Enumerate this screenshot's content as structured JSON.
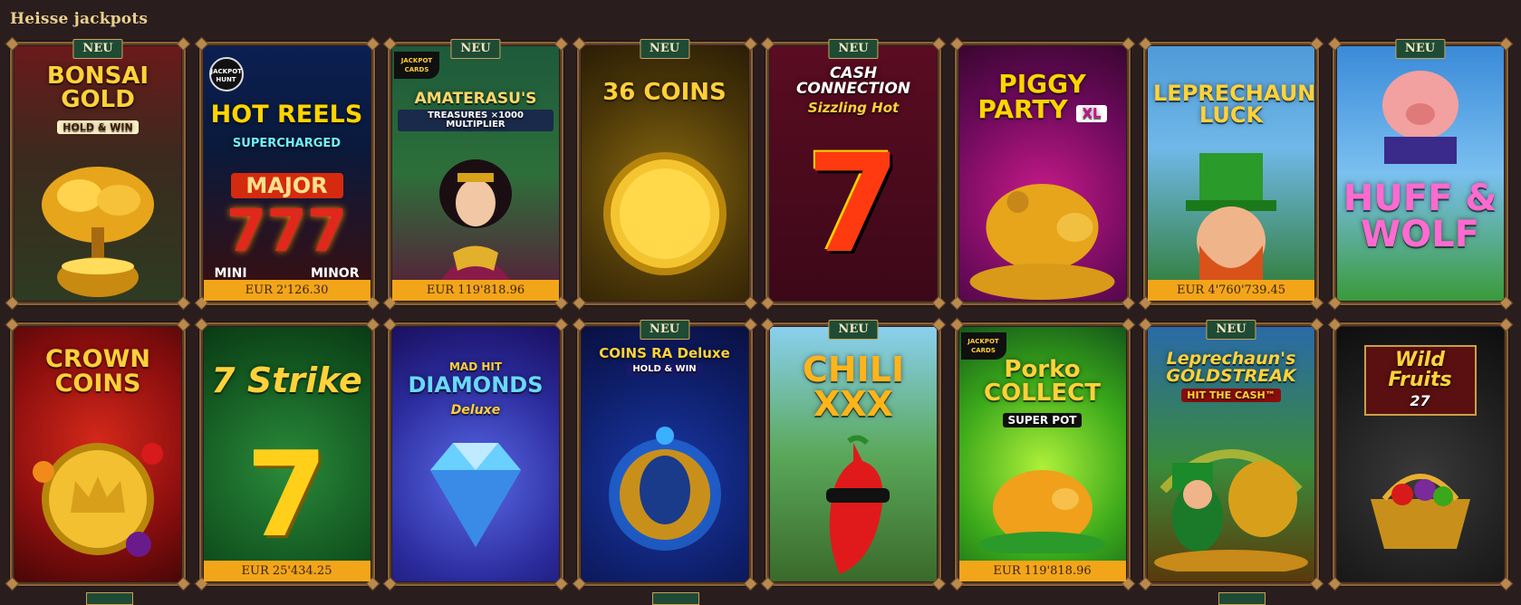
{
  "section": {
    "title": "Heisse jackpots"
  },
  "games": [
    {
      "name": "BONSAI GOLD",
      "sub": "HOLD & WIN",
      "badge": "NEU",
      "jackpot": ""
    },
    {
      "name": "HOT REELS",
      "sub": "SUPERCHARGED",
      "badge": "",
      "jackpot": "EUR 2'126.30",
      "extra": [
        "MAJOR",
        "MINI",
        "MINOR"
      ],
      "logo": "JACKPOT HUNT"
    },
    {
      "name": "AMATERASU'S",
      "sub": "TREASURES ×1000 MULTIPLIER",
      "badge": "NEU",
      "jackpot": "EUR 119'818.96",
      "logo": "JACKPOT CARDS"
    },
    {
      "name": "36 COINS",
      "sub": "",
      "badge": "NEU",
      "jackpot": ""
    },
    {
      "name": "CASH CONNECTION",
      "sub": "Sizzling Hot",
      "badge": "NEU",
      "jackpot": ""
    },
    {
      "name": "PIGGY PARTY",
      "sub": "XL",
      "badge": "",
      "jackpot": ""
    },
    {
      "name": "LEPRECHAUN'S LUCK",
      "sub": "",
      "badge": "",
      "jackpot": "EUR 4'760'739.45"
    },
    {
      "name": "HUFF & WOLF",
      "sub": "",
      "badge": "NEU",
      "jackpot": ""
    },
    {
      "name": "CROWN COINS",
      "sub": "",
      "badge": "",
      "jackpot": ""
    },
    {
      "name": "7 Strike",
      "sub": "",
      "badge": "",
      "jackpot": "EUR 25'434.25"
    },
    {
      "name": "DIAMONDS",
      "sub": "Deluxe",
      "badge": "",
      "jackpot": "",
      "logo": "MAD HIT"
    },
    {
      "name": "COINS RA Deluxe",
      "sub": "HOLD & WIN",
      "badge": "NEU",
      "jackpot": ""
    },
    {
      "name": "CHILI XXX",
      "sub": "",
      "badge": "NEU",
      "jackpot": ""
    },
    {
      "name": "Porko COLLECT",
      "sub": "SUPER POT",
      "badge": "",
      "jackpot": "EUR 119'818.96",
      "logo": "JACKPOT CARDS"
    },
    {
      "name": "Leprechaun's GOLDSTREAK",
      "sub": "HIT THE CASH™",
      "badge": "NEU",
      "jackpot": ""
    },
    {
      "name": "Wild Fruits",
      "sub": "27",
      "badge": "",
      "jackpot": ""
    }
  ],
  "colors": {
    "background": "#2a1d1e",
    "title": "#e9cf8e",
    "badge": "#1f4b34",
    "jackpot_bar": "#f3a51a"
  }
}
